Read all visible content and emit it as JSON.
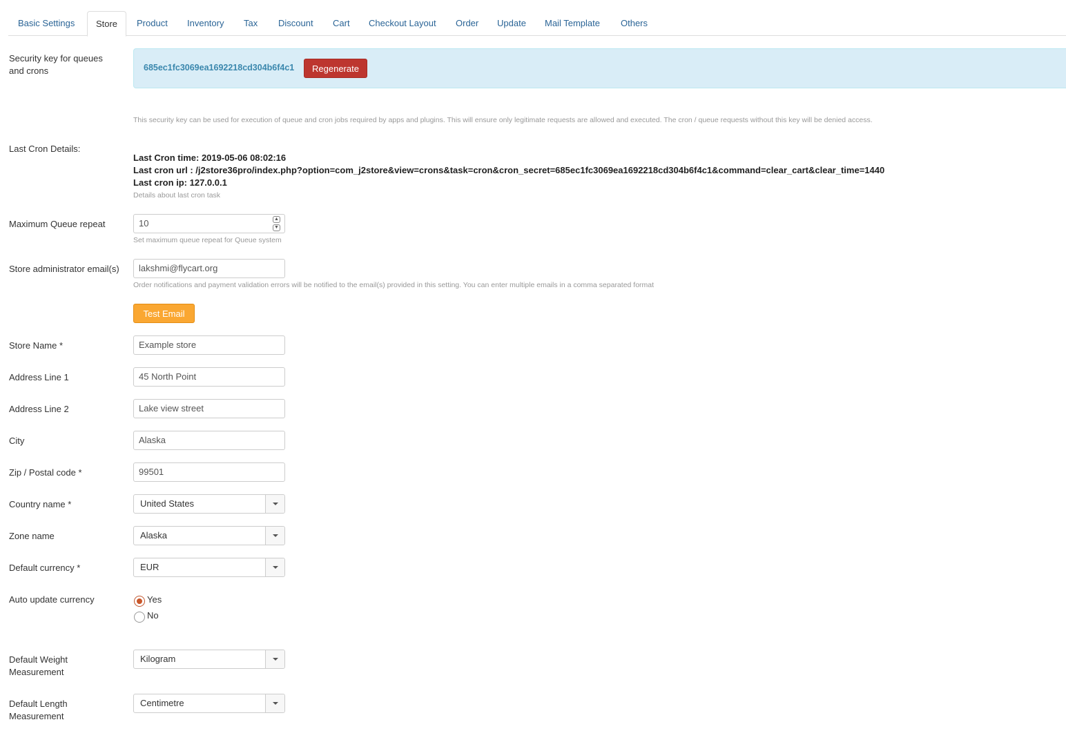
{
  "tabs": [
    {
      "label": "Basic Settings"
    },
    {
      "label": "Store"
    },
    {
      "label": "Product"
    },
    {
      "label": "Inventory"
    },
    {
      "label": "Tax"
    },
    {
      "label": "Discount"
    },
    {
      "label": "Cart"
    },
    {
      "label": "Checkout Layout"
    },
    {
      "label": "Order"
    },
    {
      "label": "Update"
    },
    {
      "label": "Mail Template"
    },
    {
      "label": "Others"
    }
  ],
  "active_tab": "Store",
  "security": {
    "label": "Security key for queues and crons",
    "key": "685ec1fc3069ea1692218cd304b6f4c1",
    "regenerate_label": "Regenerate",
    "help": "This security key can be used for execution of queue and cron jobs required by apps and plugins. This will ensure only legitimate requests are allowed and executed. The cron / queue requests without this key will be denied access."
  },
  "cron": {
    "label": "Last Cron Details:",
    "time": "Last Cron time: 2019-05-06 08:02:16",
    "url": "Last cron url : /j2store36pro/index.php?option=com_j2store&view=crons&task=cron&cron_secret=685ec1fc3069ea1692218cd304b6f4c1&command=clear_cart&clear_time=1440",
    "ip": "Last cron ip: 127.0.0.1",
    "help": "Details about last cron task"
  },
  "queue": {
    "label": "Maximum Queue repeat",
    "value": "10",
    "help": "Set maximum queue repeat for Queue system"
  },
  "admin_email": {
    "label": "Store administrator email(s)",
    "value": "lakshmi@flycart.org",
    "help": "Order notifications and payment validation errors will be notified to the email(s) provided in this setting. You can enter multiple emails in a comma separated format",
    "test_label": "Test Email"
  },
  "fields": {
    "store_name": {
      "label": "Store Name *",
      "value": "Example store"
    },
    "address1": {
      "label": "Address Line 1",
      "value": "45 North Point"
    },
    "address2": {
      "label": "Address Line 2",
      "value": "Lake view street"
    },
    "city": {
      "label": "City",
      "value": "Alaska"
    },
    "zip": {
      "label": "Zip / Postal code *",
      "value": "99501"
    },
    "country": {
      "label": "Country name *",
      "value": "United States"
    },
    "zone": {
      "label": "Zone name",
      "value": "Alaska"
    },
    "currency": {
      "label": "Default currency *",
      "value": "EUR"
    },
    "auto_update": {
      "label": "Auto update currency",
      "yes": "Yes",
      "no": "No",
      "selected": "Yes"
    },
    "weight": {
      "label": "Default Weight Measurement",
      "value": "Kilogram"
    },
    "length": {
      "label": "Default Length Measurement",
      "value": "Centimetre"
    }
  },
  "colors": {
    "link": "#2a6496",
    "regenerate": "#bd362f",
    "test_email": "#faa732",
    "alert_bg": "#d9edf7",
    "key_text": "#3a87ad"
  }
}
